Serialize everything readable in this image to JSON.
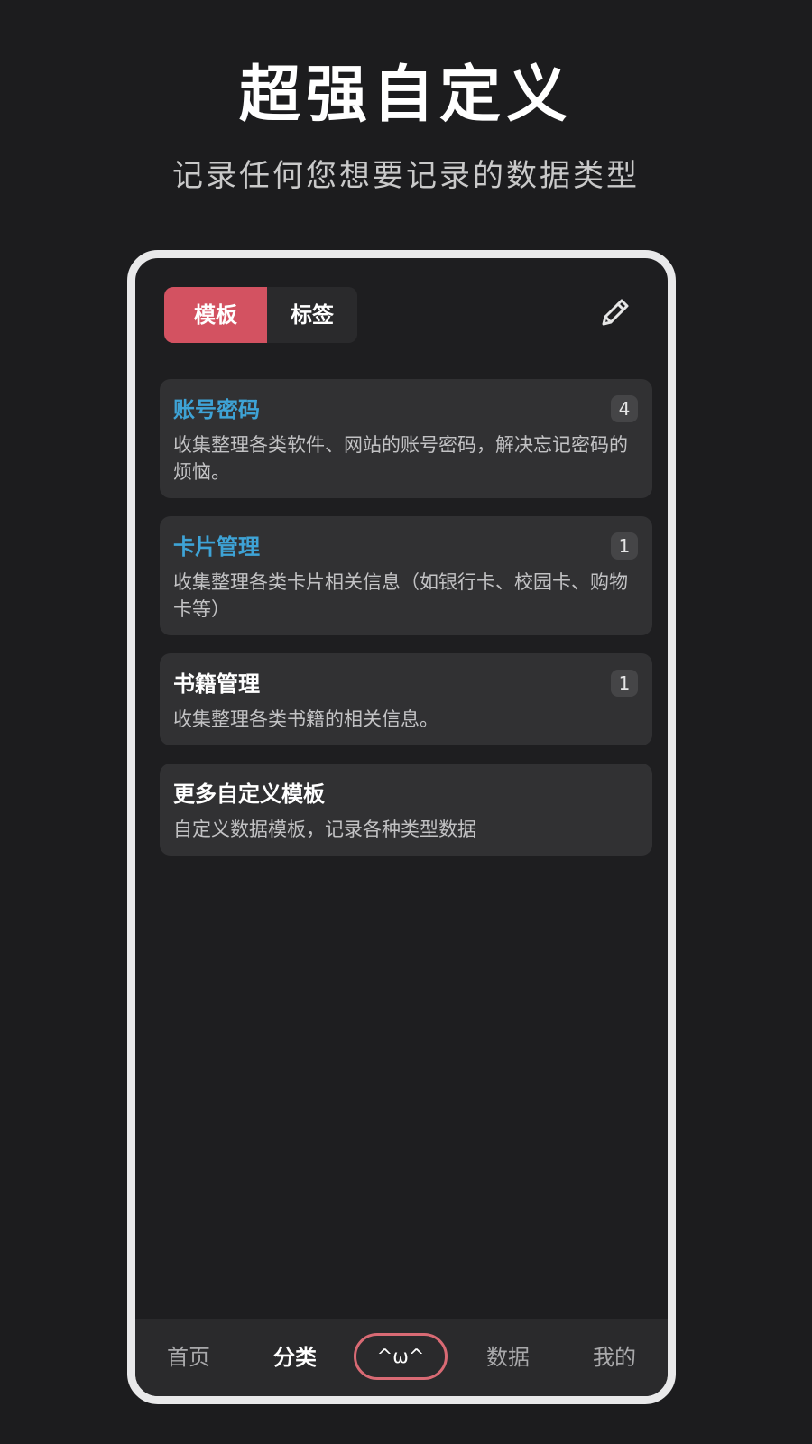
{
  "promo": {
    "headline": "超强自定义",
    "subline": "记录任何您想要记录的数据类型"
  },
  "segmented": {
    "templates_label": "模板",
    "tags_label": "标签",
    "active": "templates"
  },
  "edit_icon": "pencil-icon",
  "colors": {
    "accent_red": "#d35261",
    "accent_blue": "#3ea3d6",
    "background": "#1c1c1e",
    "card": "#313133",
    "frame": "#e9e9ea"
  },
  "templates": [
    {
      "title": "账号密码",
      "description": "收集整理各类软件、网站的账号密码，解决忘记密码的烦恼。",
      "count": "4",
      "highlighted": true
    },
    {
      "title": "卡片管理",
      "description": "收集整理各类卡片相关信息（如银行卡、校园卡、购物卡等）",
      "count": "1",
      "highlighted": true
    },
    {
      "title": "书籍管理",
      "description": "收集整理各类书籍的相关信息。",
      "count": "1",
      "highlighted": false
    },
    {
      "title": "更多自定义模板",
      "description": "自定义数据模板，记录各种类型数据",
      "highlighted": false
    }
  ],
  "tabbar": {
    "home": "首页",
    "category": "分类",
    "center": "^ω^",
    "data": "数据",
    "mine": "我的",
    "selected": "category"
  }
}
